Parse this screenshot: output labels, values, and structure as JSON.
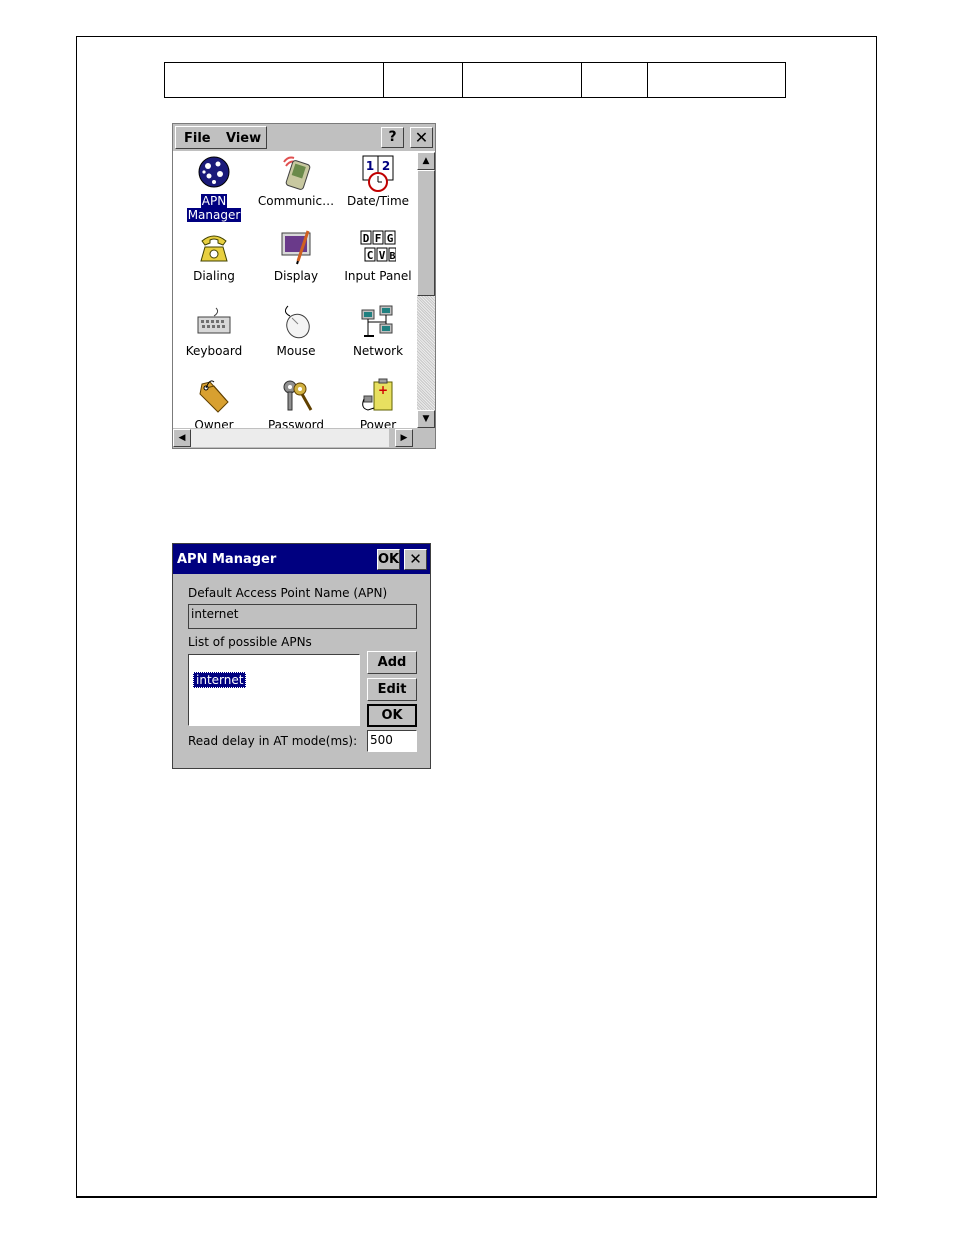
{
  "control_panel": {
    "menu": {
      "file": "File",
      "view": "View"
    },
    "help_button": "?",
    "close_button": "✕",
    "items": [
      {
        "label": "APN",
        "label2": "Manager",
        "icon": "globe-icon",
        "selected": true
      },
      {
        "label": "Communic…",
        "icon": "communication-icon"
      },
      {
        "label": "Date/Time",
        "icon": "calendar-clock-icon"
      },
      {
        "label": "Dialing",
        "icon": "telephone-icon"
      },
      {
        "label": "Display",
        "icon": "display-icon"
      },
      {
        "label": "Input Panel",
        "icon": "input-panel-icon"
      },
      {
        "label": "Keyboard",
        "icon": "keyboard-icon"
      },
      {
        "label": "Mouse",
        "icon": "mouse-icon"
      },
      {
        "label": "Network",
        "icon": "network-icon"
      },
      {
        "label": "Owner",
        "icon": "owner-tag-icon"
      },
      {
        "label": "Password",
        "icon": "password-keys-icon"
      },
      {
        "label": "Power",
        "icon": "power-icon"
      }
    ],
    "input_panel_letters": [
      "D",
      "F",
      "G",
      "C",
      "V",
      "B"
    ],
    "datetime_digits": [
      "1",
      "2"
    ]
  },
  "apn_dialog": {
    "title": "APN Manager",
    "ok_title": "OK",
    "close": "✕",
    "default_label": "Default Access Point Name (APN)",
    "default_value": "internet",
    "list_label": "List of possible APNs",
    "list_items": [
      "internet"
    ],
    "add": "Add",
    "edit": "Edit",
    "ok": "OK",
    "delay_label": "Read delay in AT mode(ms):",
    "delay_value": "500"
  },
  "colors": {
    "selection": "#000080",
    "titlebar": "#000080",
    "face": "#c0c0c0"
  }
}
